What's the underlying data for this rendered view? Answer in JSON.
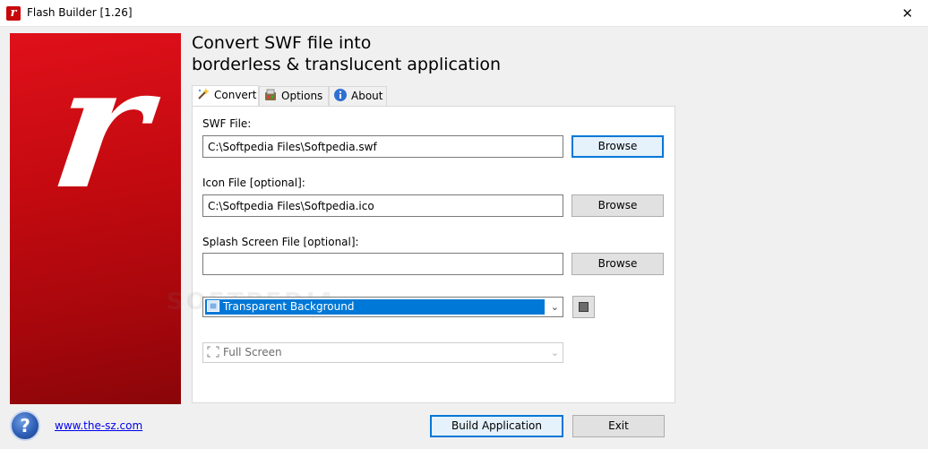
{
  "window": {
    "title": "Flash Builder [1.26]",
    "close_glyph": "✕",
    "app_icon_letter": "r"
  },
  "logo": {
    "letter": "r",
    "color": "#c40a10"
  },
  "headline": {
    "line1": "Convert SWF file into",
    "line2": "borderless & translucent application"
  },
  "tabs": [
    {
      "label": "Convert",
      "icon": "magic-wand-icon",
      "active": true
    },
    {
      "label": "Options",
      "icon": "options-icon",
      "active": false
    },
    {
      "label": "About",
      "icon": "info-icon",
      "active": false
    }
  ],
  "convert": {
    "swf_label": "SWF File:",
    "swf_value": "C:\\Softpedia Files\\Softpedia.swf",
    "icon_label": "Icon File [optional]:",
    "icon_value": "C:\\Softpedia Files\\Softpedia.ico",
    "splash_label": "Splash Screen File [optional]:",
    "splash_value": "",
    "browse_label": "Browse",
    "background_mode": "Transparent Background",
    "window_mode": "Full Screen"
  },
  "watermark": "SOFTPEDIA",
  "footer": {
    "link": "www.the-sz.com",
    "help_glyph": "?",
    "build_label": "Build Application",
    "exit_label": "Exit"
  },
  "colors": {
    "accent": "#0078d7",
    "logo_red": "#c40a10",
    "link": "#0000ee"
  }
}
